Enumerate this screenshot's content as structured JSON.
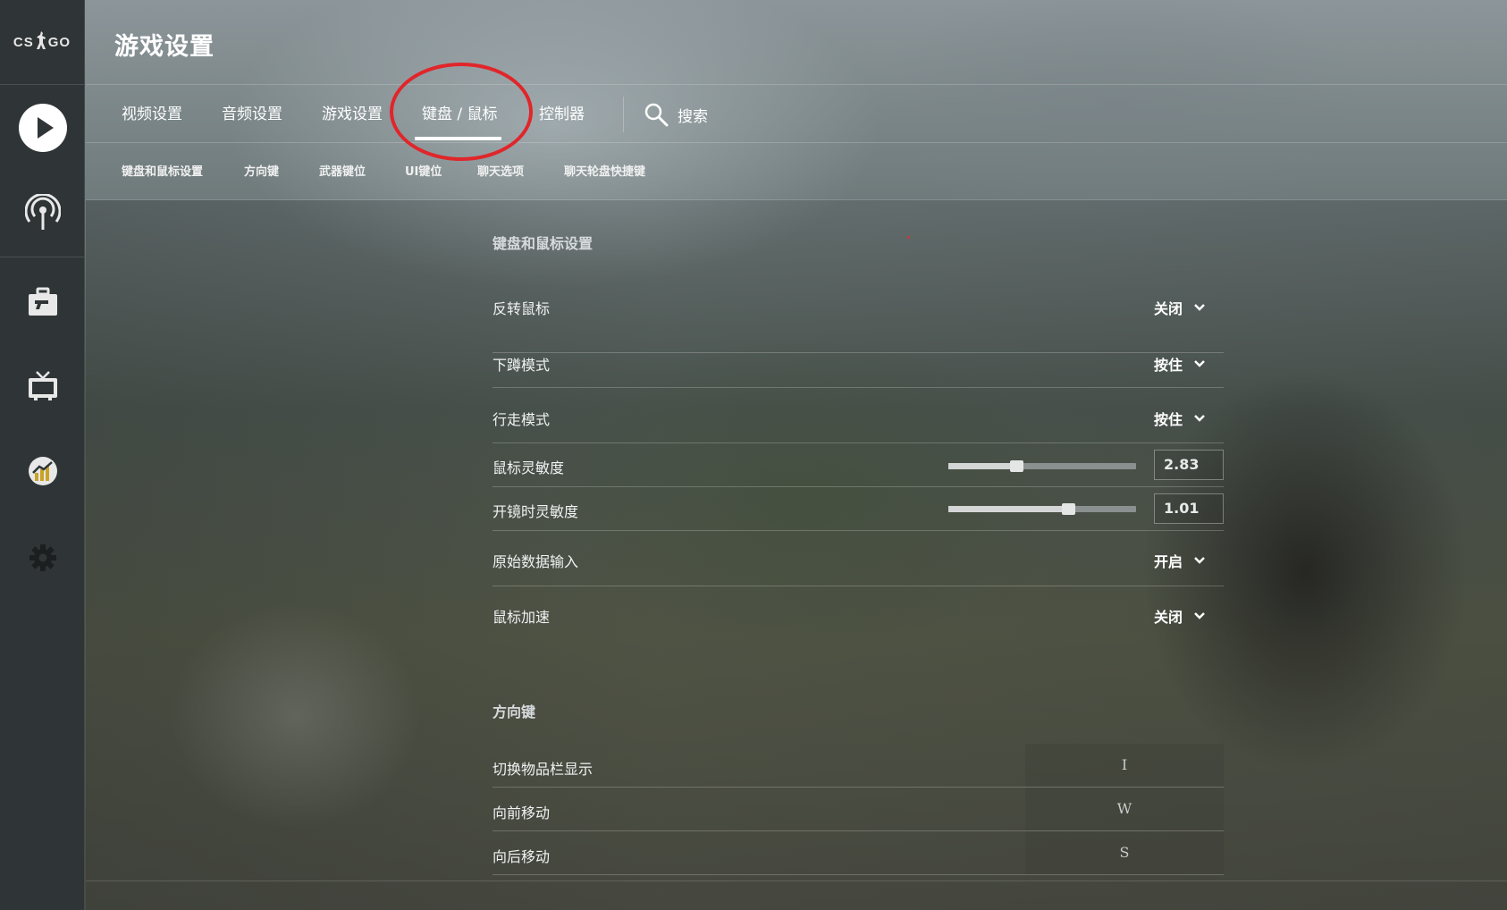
{
  "app": {
    "logo_text_left": "CS",
    "logo_text_right": "GO"
  },
  "header": {
    "title": "游戏设置"
  },
  "tabs": [
    {
      "label": "视频设置"
    },
    {
      "label": "音频设置"
    },
    {
      "label": "游戏设置"
    },
    {
      "label": "键盘 / 鼠标",
      "active": true
    },
    {
      "label": "控制器"
    }
  ],
  "search": {
    "label": "搜索"
  },
  "subtabs": [
    {
      "label": "键盘和鼠标设置"
    },
    {
      "label": "方向键"
    },
    {
      "label": "武器键位"
    },
    {
      "label": "UI键位"
    },
    {
      "label": "聊天选项"
    },
    {
      "label": "聊天轮盘快捷键"
    }
  ],
  "sections": {
    "keyboard_mouse": {
      "title": "键盘和鼠标设置",
      "rows": [
        {
          "label": "反转鼠标",
          "value": "关闭"
        },
        {
          "label": "下蹲模式",
          "value": "按住"
        },
        {
          "label": "行走模式",
          "value": "按住"
        },
        {
          "label": "鼠标灵敏度",
          "value": "2.83",
          "slider_fraction": 0.36
        },
        {
          "label": "开镜时灵敏度",
          "value": "1.01",
          "slider_fraction": 0.64
        },
        {
          "label": "原始数据输入",
          "value": "开启"
        },
        {
          "label": "鼠标加速",
          "value": "关闭"
        }
      ]
    },
    "movement": {
      "title": "方向键",
      "rows": [
        {
          "label": "切换物品栏显示",
          "key": "I"
        },
        {
          "label": "向前移动",
          "key": "W"
        },
        {
          "label": "向后移动",
          "key": "S"
        }
      ]
    }
  },
  "colors": {
    "annotation": "#e0262a",
    "sidebar": "#2f3436"
  }
}
